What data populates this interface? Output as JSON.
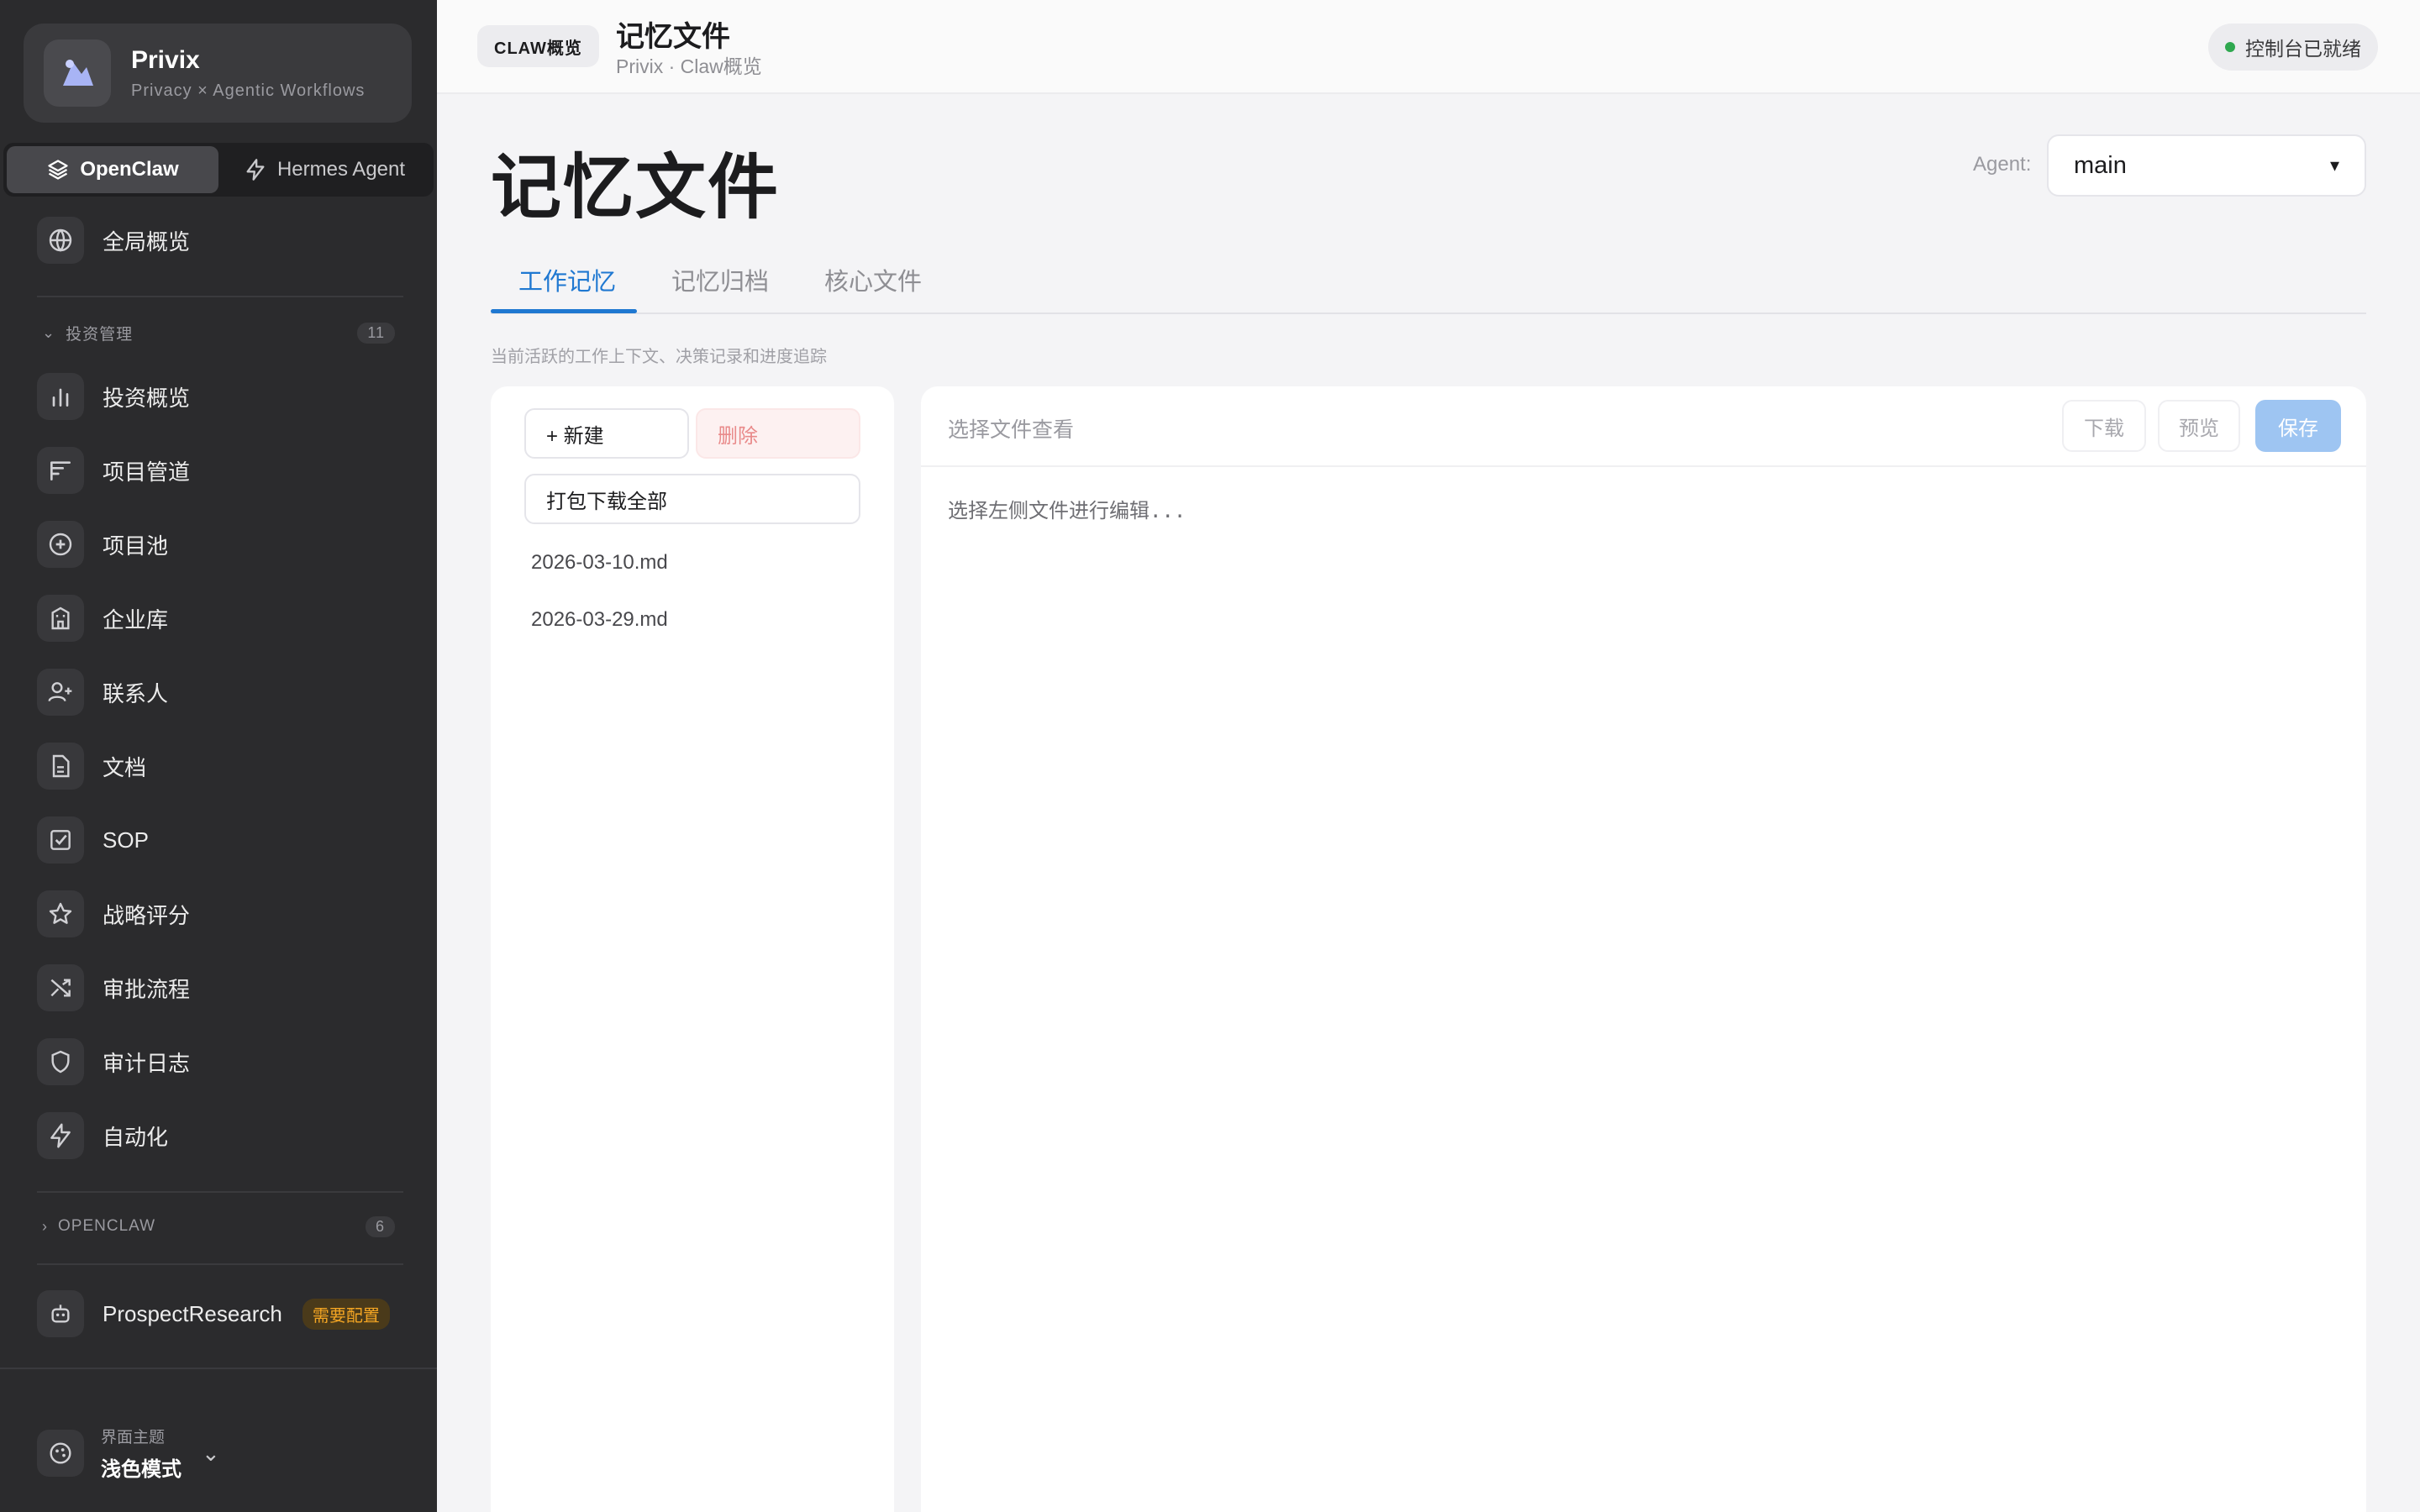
{
  "brand": {
    "name": "Privix",
    "tagline": "Privacy × Agentic Workflows"
  },
  "mode_switch": {
    "openclaw": "OpenClaw",
    "hermes": "Hermes Agent"
  },
  "overview_item": {
    "label": "全局概览",
    "icon": "globe-icon"
  },
  "group_invest": {
    "title": "投资管理",
    "count": "11",
    "items": [
      {
        "label": "投资概览",
        "icon": "bar-chart-icon"
      },
      {
        "label": "项目管道",
        "icon": "pipeline-icon"
      },
      {
        "label": "项目池",
        "icon": "plus-circle-icon"
      },
      {
        "label": "企业库",
        "icon": "building-icon"
      },
      {
        "label": "联系人",
        "icon": "user-plus-icon"
      },
      {
        "label": "文档",
        "icon": "document-icon"
      },
      {
        "label": "SOP",
        "icon": "checkbox-icon"
      },
      {
        "label": "战略评分",
        "icon": "star-icon"
      },
      {
        "label": "审批流程",
        "icon": "shuffle-icon"
      },
      {
        "label": "审计日志",
        "icon": "shield-icon"
      },
      {
        "label": "自动化",
        "icon": "lightning-icon"
      }
    ]
  },
  "group_openclaw": {
    "title": "OPENCLAW",
    "count": "6"
  },
  "agent_item": {
    "label": "ProspectResearch",
    "badge": "需要配置",
    "icon": "robot-icon"
  },
  "theme": {
    "label": "界面主题",
    "value": "浅色模式"
  },
  "topbar": {
    "chip": "CLAW概览",
    "title": "记忆文件",
    "subtitle": "Privix · Claw概览",
    "status": "控制台已就绪"
  },
  "page": {
    "title": "记忆文件",
    "agent_label": "Agent:",
    "agent_value": "main",
    "tabs": [
      "工作记忆",
      "记忆归档",
      "核心文件"
    ],
    "hint": "当前活跃的工作上下文、决策记录和进度追踪"
  },
  "file_list": {
    "new_label": "+ 新建",
    "delete_label": "删除",
    "pack_label": "打包下载全部",
    "files": [
      "2026-03-10.md",
      "2026-03-29.md"
    ]
  },
  "editor": {
    "file_placeholder": "选择文件查看",
    "download_label": "下载",
    "preview_label": "预览",
    "save_label": "保存",
    "content_placeholder": "选择左侧文件进行编辑..."
  },
  "colors": {
    "accent": "#1f78d1",
    "sidebar_bg": "#2b2b2d",
    "status_ok": "#2fa84f",
    "warn": "#f5a623"
  }
}
